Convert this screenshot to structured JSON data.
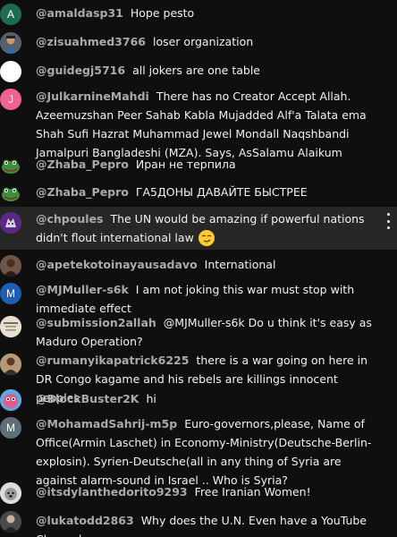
{
  "messages": [
    {
      "author": "@amaldasp31",
      "text": "Hope pesto",
      "avatar_letter": "A"
    },
    {
      "author": "@zisuahmed3766",
      "text": "loser organization"
    },
    {
      "author": "@guidegj5716",
      "text": "all jokers are one table"
    },
    {
      "author": "@JulkarnineMahdi",
      "text": "There has no Creator Accept Allah. Azeemuzshan Peer Sahab Kabla Mujadded Alf'a Talata ema Shah Sufi Hazrat Muhammad Jewel Mondall Naqshbandi Jamalpuri Bangladeshi (MZA). Says, AsSalamu Alaikum",
      "avatar_letter": "J"
    },
    {
      "author": "@Zhaba_Pepro",
      "text": "Иран не терпила"
    },
    {
      "author": "@Zhaba_Pepro",
      "text": "ГА5ДОНЫ ДАВАЙТЕ БЫСТРЕЕ"
    },
    {
      "author": "@chpoules",
      "text": "The UN would be amazing if powerful nations didn't flout international law"
    },
    {
      "author": "@apetekotoinayausadavo",
      "text": "International"
    },
    {
      "author": "@MJMuller-s6k",
      "text": "I am not joking this war must stop with immediate effect",
      "avatar_letter": "M"
    },
    {
      "author": "@submission2allah",
      "text": "@MJMuller-s6k Do u think it's easy as Maduro Operation?"
    },
    {
      "author": "@rumanyikapatrick6225",
      "text": "there is a war going on here in DR Congo kagame and his rebels are killings innocent peoples"
    },
    {
      "author": "@BlockBuster2K",
      "text": "hi"
    },
    {
      "author": "@MohamadSahrij-m5p",
      "text": "Euro-governors,please, Name of Office(Armin Laschet) in Economy-Ministry(Deutsche-Berlin-explosin). Syrien-Deutsche(all in any thing of Syria are against alarm-sound in Israel .. Who is Syria?",
      "avatar_letter": "M"
    },
    {
      "author": "@itsdylanthedorito9293",
      "text": "Free Iranian Women!"
    },
    {
      "author": "@lukatodd2863",
      "text": "Why does the U.N. Even have a YouTube Channel"
    }
  ],
  "colors": {
    "background": "#0f0f0f",
    "hover_row": "#272727",
    "author": "#aaaaaa",
    "text": "#f1f1f1"
  },
  "icons": {
    "emoji": "smirking-face-icon",
    "more": "more-vertical-icon"
  }
}
